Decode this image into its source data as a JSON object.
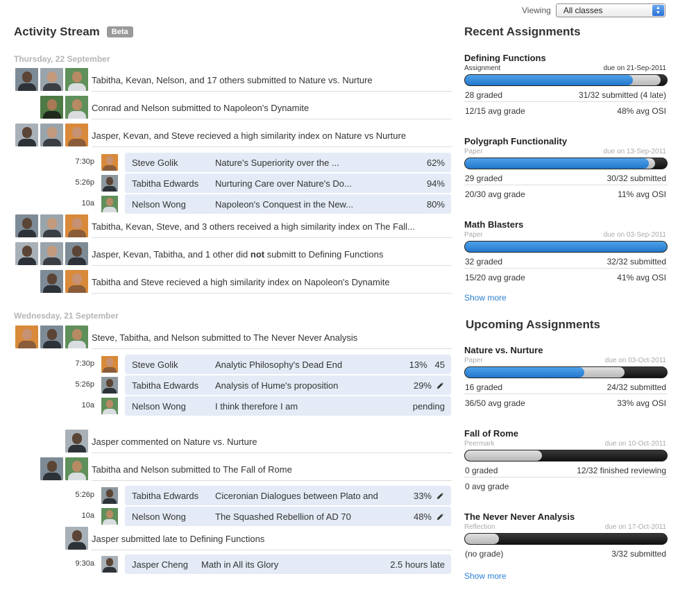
{
  "viewing": {
    "label": "Viewing",
    "selected": "All classes"
  },
  "stream": {
    "title": "Activity Stream",
    "badge": "Beta",
    "days": [
      {
        "label": "Thursday, 22 September",
        "rows": [
          {
            "text": "Tabitha, Kevan, Nelson, and 17 others submitted to Nature vs. Nurture"
          },
          {
            "text": "Conrad and Nelson submitted to Napoleon's Dynamite"
          },
          {
            "text": "Jasper, Kevan, and Steve recieved a high similarity index on Nature vs Nurture"
          },
          {
            "text": "Tabitha, Kevan, Steve, and 3 others received a high similarity index on The Fall..."
          },
          {
            "pre": "Jasper, Kevan, Tabitha, and 1 other did ",
            "bold": "not",
            "post": " submitt to Defining Functions"
          },
          {
            "text": "Tabitha and Steve recieved a high similarity index on Napoleon's Dynamite"
          }
        ],
        "subs": [
          {
            "time": "7:30p",
            "name": "Steve Golik",
            "title": "Nature's Superiority over the ...",
            "score": "62%"
          },
          {
            "time": "5:26p",
            "name": "Tabitha Edwards",
            "title": "Nurturing Care over Nature's Do...",
            "score": "94%"
          },
          {
            "time": "10a",
            "name": "Nelson Wong",
            "title": "Napoleon's Conquest in the New...",
            "score": "80%"
          }
        ]
      },
      {
        "label": "Wednesday, 21 September",
        "rows": [
          {
            "text": "Steve, Tabitha, and Nelson submitted to The Never Never Analysis"
          },
          {
            "text": "Jasper commented on Nature vs. Nurture"
          },
          {
            "text": "Tabitha and Nelson submitted to The Fall of Rome"
          },
          {
            "text": "Jasper submitted late to Defining Functions"
          }
        ],
        "subs": [
          {
            "time": "7:30p",
            "name": "Steve Golik",
            "title": "Analytic Philosophy's Dead End",
            "score": "13%",
            "extra": "45"
          },
          {
            "time": "5:26p",
            "name": "Tabitha Edwards",
            "title": "Analysis of Hume's proposition",
            "score": "29%"
          },
          {
            "time": "10a",
            "name": "Nelson Wong",
            "title": "I think therefore I am",
            "score": "pending"
          },
          {
            "time": "5:26p",
            "name": "Tabitha Edwards",
            "title": "Ciceronian Dialogues between Plato and",
            "score": "33%"
          },
          {
            "time": "10a",
            "name": "Nelson Wong",
            "title": "The Squashed Rebellion of AD 70",
            "score": "48%"
          },
          {
            "time": "9:30a",
            "name": "Jasper Cheng",
            "title": "Math in All its Glory",
            "score": "2.5 hours late"
          }
        ]
      }
    ]
  },
  "recent": {
    "title": "Recent Assignments",
    "show_more": "Show more",
    "items": [
      {
        "title": "Defining Functions",
        "type": "Assignment",
        "due": "due on 21-Sep-2011",
        "graded_fraction": 0.83,
        "submitted_fraction": 0.97,
        "l1": "28 graded",
        "r1": "31/32 submitted (4 late)",
        "l2": "12/15 avg grade",
        "r2": "48% avg OSI"
      },
      {
        "title": "Polygraph Functionality",
        "type": "Paper",
        "due": "due on 13-Sep-2011",
        "graded_fraction": 0.91,
        "submitted_fraction": 0.94,
        "l1": "29 graded",
        "r1": "30/32 submitted",
        "l2": "20/30 avg grade",
        "r2": "11% avg OSI"
      },
      {
        "title": "Math Blasters",
        "type": "Paper",
        "due": "due on 03-Sep-2011",
        "graded_fraction": 1.0,
        "submitted_fraction": 1.0,
        "l1": "32 graded",
        "r1": "32/32 submitted",
        "l2": "15/20 avg grade",
        "r2": "41% avg OSI"
      }
    ]
  },
  "upcoming": {
    "title": "Upcoming Assignments",
    "show_more": "Show more",
    "items": [
      {
        "title": "Nature vs. Nurture",
        "type": "Paper",
        "due": "due on 03-Oct-2011",
        "graded_fraction": 0.59,
        "submitted_fraction": 0.79,
        "l1": "16 graded",
        "r1": "24/32 submitted",
        "l2": "36/50 avg grade",
        "r2": "33% avg OSI"
      },
      {
        "title": "Fall of Rome",
        "type": "Peermark",
        "due": "due on 10-Oct-2011",
        "graded_fraction": 0.0,
        "submitted_fraction": 0.38,
        "l1": "0 graded",
        "r1": "12/32 finished reviewing",
        "l2": "0 avg grade",
        "r2": ""
      },
      {
        "title": "The Never Never Analysis",
        "type": "Reflection",
        "due": "due on 17-Oct-2011",
        "graded_fraction": 0.0,
        "submitted_fraction": 0.17,
        "l1": "(no grade)",
        "r1": "3/32 submitted"
      }
    ]
  },
  "colors": {
    "accent": "#2a7fd0",
    "bar_blue": "#3b8ee0",
    "sub_bg": "#e4ebf6"
  }
}
